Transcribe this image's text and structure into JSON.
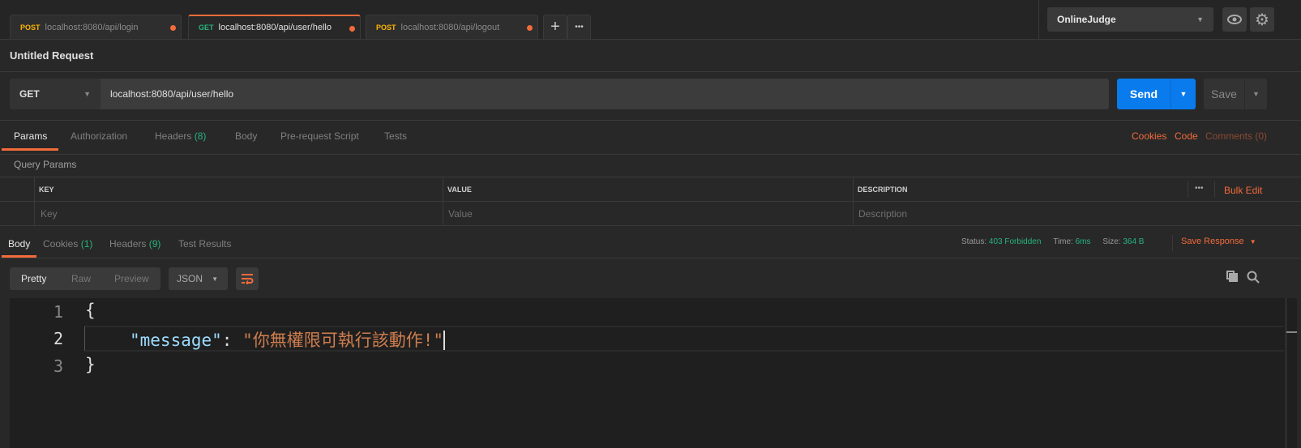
{
  "tabs": [
    {
      "method": "POST",
      "url": "localhost:8080/api/login",
      "active": false
    },
    {
      "method": "GET",
      "url": "localhost:8080/api/user/hello",
      "active": true
    },
    {
      "method": "POST",
      "url": "localhost:8080/api/logout",
      "active": false
    }
  ],
  "tab_actions": {
    "add": "+",
    "more": "•••"
  },
  "environment": {
    "selected": "OnlineJudge"
  },
  "request": {
    "title": "Untitled Request",
    "method": "GET",
    "url": "localhost:8080/api/user/hello",
    "send_label": "Send",
    "save_label": "Save"
  },
  "request_tabs": {
    "params": "Params",
    "authorization": "Authorization",
    "headers": "Headers",
    "headers_count": "(8)",
    "body": "Body",
    "prerequest": "Pre-request Script",
    "tests": "Tests"
  },
  "request_links": {
    "cookies": "Cookies",
    "code": "Code",
    "comments": "Comments (0)"
  },
  "query_params": {
    "title": "Query Params",
    "columns": [
      "KEY",
      "VALUE",
      "DESCRIPTION"
    ],
    "placeholders": [
      "Key",
      "Value",
      "Description"
    ],
    "more": "•••",
    "bulk_edit": "Bulk Edit"
  },
  "response_tabs": {
    "body": "Body",
    "cookies": "Cookies",
    "cookies_count": "(1)",
    "headers": "Headers",
    "headers_count": "(9)",
    "test_results": "Test Results"
  },
  "response_meta": {
    "status_label": "Status:",
    "status": "403 Forbidden",
    "time_label": "Time:",
    "time": "6ms",
    "size_label": "Size:",
    "size": "364 B",
    "save_response": "Save Response"
  },
  "view": {
    "pretty": "Pretty",
    "raw": "Raw",
    "preview": "Preview",
    "format": "JSON"
  },
  "code": {
    "lines": [
      "1",
      "2",
      "3"
    ],
    "open": "{",
    "key": "\"message\"",
    "colon": ":",
    "value": "\"你無權限可執行該動作!\"",
    "close": "}"
  },
  "colors": {
    "accent": "#f26b3a",
    "send": "#097bed",
    "green": "#26b47f",
    "post": "#ffb400",
    "get": "#26b47f"
  }
}
